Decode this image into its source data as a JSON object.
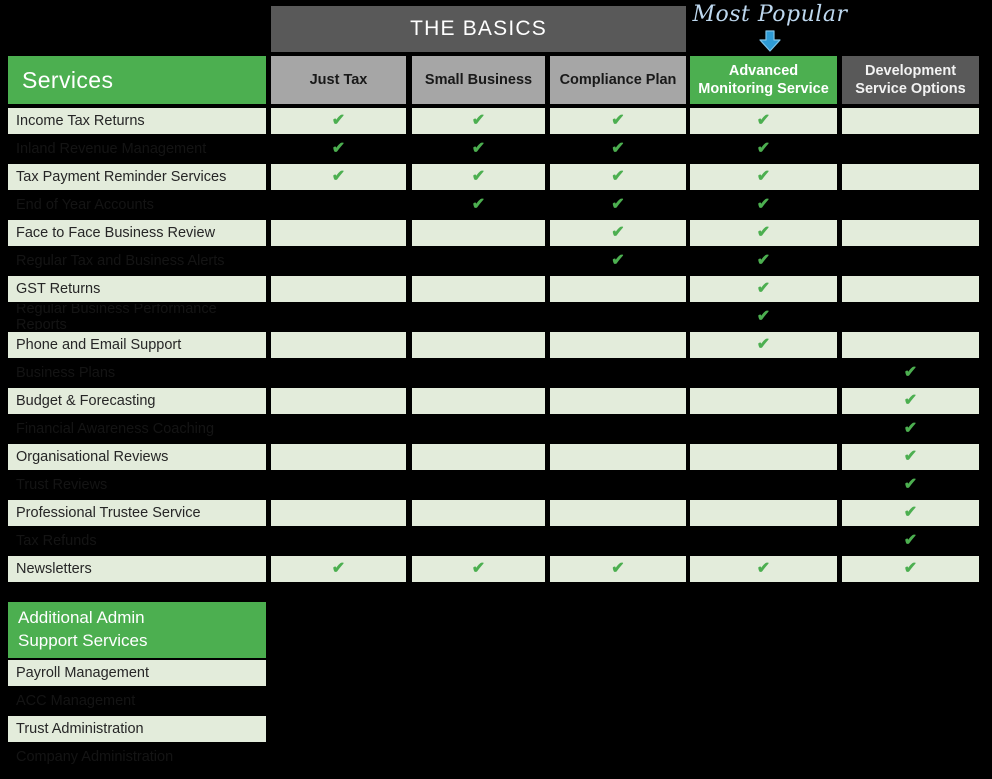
{
  "banner": {
    "label": "THE BASICS"
  },
  "callout": {
    "label": "Most Popular",
    "arrow_icon": "down-arrow-icon",
    "arrow_color": "#2E9BD6"
  },
  "colors": {
    "accent_green": "#4CAF50",
    "cell_green": "#E3ECDB",
    "header_grey": "#A6A6A6",
    "banner_grey": "#595959",
    "tick_green": "#4CAF50",
    "callout_blue": "#BDD7EE",
    "background": "#000000"
  },
  "table": {
    "services_header": "Services",
    "columns": [
      {
        "label": "Just Tax",
        "style": "grey"
      },
      {
        "label": "Small Business",
        "style": "grey"
      },
      {
        "label": "Compliance Plan",
        "style": "grey"
      },
      {
        "label": "Advanced Monitoring Service",
        "style": "green"
      },
      {
        "label": "Development Service Options",
        "style": "darkgrey"
      }
    ],
    "tick_glyph": "✔",
    "rows": [
      {
        "label": "Income Tax Returns",
        "ticks": [
          true,
          true,
          true,
          true,
          false
        ]
      },
      {
        "label": "Inland Revenue Management",
        "ticks": [
          true,
          true,
          true,
          true,
          false
        ]
      },
      {
        "label": "Tax Payment Reminder Services",
        "ticks": [
          true,
          true,
          true,
          true,
          false
        ]
      },
      {
        "label": "End of Year Accounts",
        "ticks": [
          false,
          true,
          true,
          true,
          false
        ]
      },
      {
        "label": "Face to Face Business Review",
        "ticks": [
          false,
          false,
          true,
          true,
          false
        ]
      },
      {
        "label": "Regular Tax and Business Alerts",
        "ticks": [
          false,
          false,
          true,
          true,
          false
        ]
      },
      {
        "label": "GST Returns",
        "ticks": [
          false,
          false,
          false,
          true,
          false
        ]
      },
      {
        "label": "Regular Business Performance Reports",
        "ticks": [
          false,
          false,
          false,
          true,
          false
        ]
      },
      {
        "label": "Phone and Email Support",
        "ticks": [
          false,
          false,
          false,
          true,
          false
        ]
      },
      {
        "label": "Business Plans",
        "ticks": [
          false,
          false,
          false,
          false,
          true
        ]
      },
      {
        "label": "Budget & Forecasting",
        "ticks": [
          false,
          false,
          false,
          false,
          true
        ]
      },
      {
        "label": "Financial Awareness Coaching",
        "ticks": [
          false,
          false,
          false,
          false,
          true
        ]
      },
      {
        "label": "Organisational Reviews",
        "ticks": [
          false,
          false,
          false,
          false,
          true
        ]
      },
      {
        "label": "Trust Reviews",
        "ticks": [
          false,
          false,
          false,
          false,
          true
        ]
      },
      {
        "label": "Professional Trustee Service",
        "ticks": [
          false,
          false,
          false,
          false,
          true
        ]
      },
      {
        "label": "Tax Refunds",
        "ticks": [
          false,
          false,
          false,
          false,
          true
        ]
      },
      {
        "label": "Newsletters",
        "ticks": [
          true,
          true,
          true,
          true,
          true
        ]
      }
    ]
  },
  "admin": {
    "header_line1": "Additional Admin",
    "header_line2": "Support Services",
    "rows": [
      {
        "label": "Payroll Management"
      },
      {
        "label": "ACC Management"
      },
      {
        "label": "Trust Administration"
      },
      {
        "label": "Company Administration"
      }
    ]
  }
}
